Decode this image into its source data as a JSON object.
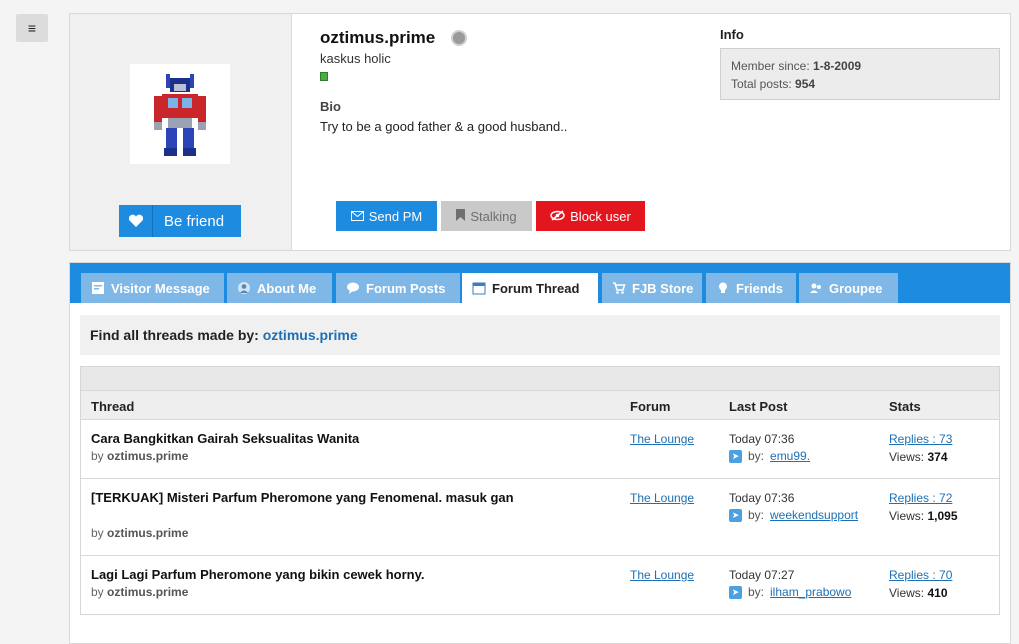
{
  "menu": {
    "icon": "hamburger-icon",
    "glyph": "≡"
  },
  "profile": {
    "username": "oztimus.prime",
    "rank": "kaskus holic",
    "bio_label": "Bio",
    "bio": "Try to be a good father & a good husband..",
    "be_friend": "Be friend",
    "info_label": "Info",
    "member_since_label": "Member since:",
    "member_since": "1-8-2009",
    "total_posts_label": "Total posts:",
    "total_posts": "954",
    "actions": {
      "send_pm": "Send PM",
      "stalking": "Stalking",
      "block": "Block user"
    }
  },
  "tabs": [
    {
      "label": "Visitor Message",
      "icon": "message-icon"
    },
    {
      "label": "About Me",
      "icon": "user-icon"
    },
    {
      "label": "Forum Posts",
      "icon": "chat-icon"
    },
    {
      "label": "Forum Thread",
      "icon": "calendar-icon",
      "active": true
    },
    {
      "label": "FJB Store",
      "icon": "cart-icon"
    },
    {
      "label": "Friends",
      "icon": "bulb-icon"
    },
    {
      "label": "Groupee",
      "icon": "group-icon"
    }
  ],
  "find": {
    "label": "Find all threads made by:",
    "user": "oztimus.prime"
  },
  "table": {
    "headers": {
      "thread": "Thread",
      "forum": "Forum",
      "last_post": "Last Post",
      "stats": "Stats"
    },
    "rows": [
      {
        "title": "Cara Bangkitkan Gairah Seksualitas Wanita",
        "by_label": "by",
        "author": "oztimus.prime",
        "forum": "The Lounge",
        "time": "Today 07:36",
        "lp_by": "by:",
        "lp_user": "emu99.",
        "replies": "Replies : 73",
        "views_label": "Views:",
        "views": "374"
      },
      {
        "title": "[TERKUAK] Misteri Parfum Pheromone yang Fenomenal. masuk gan",
        "by_label": "by",
        "author": "oztimus.prime",
        "forum": "The Lounge",
        "time": "Today 07:36",
        "lp_by": "by:",
        "lp_user": "weekendsupport",
        "replies": "Replies : 72",
        "views_label": "Views:",
        "views": "1,095"
      },
      {
        "title": "Lagi Lagi Parfum Pheromone yang bikin cewek horny.",
        "by_label": "by",
        "author": "oztimus.prime",
        "forum": "The Lounge",
        "time": "Today 07:27",
        "lp_by": "by:",
        "lp_user": "ilham_prabowo",
        "replies": "Replies : 70",
        "views_label": "Views:",
        "views": "410"
      }
    ]
  }
}
